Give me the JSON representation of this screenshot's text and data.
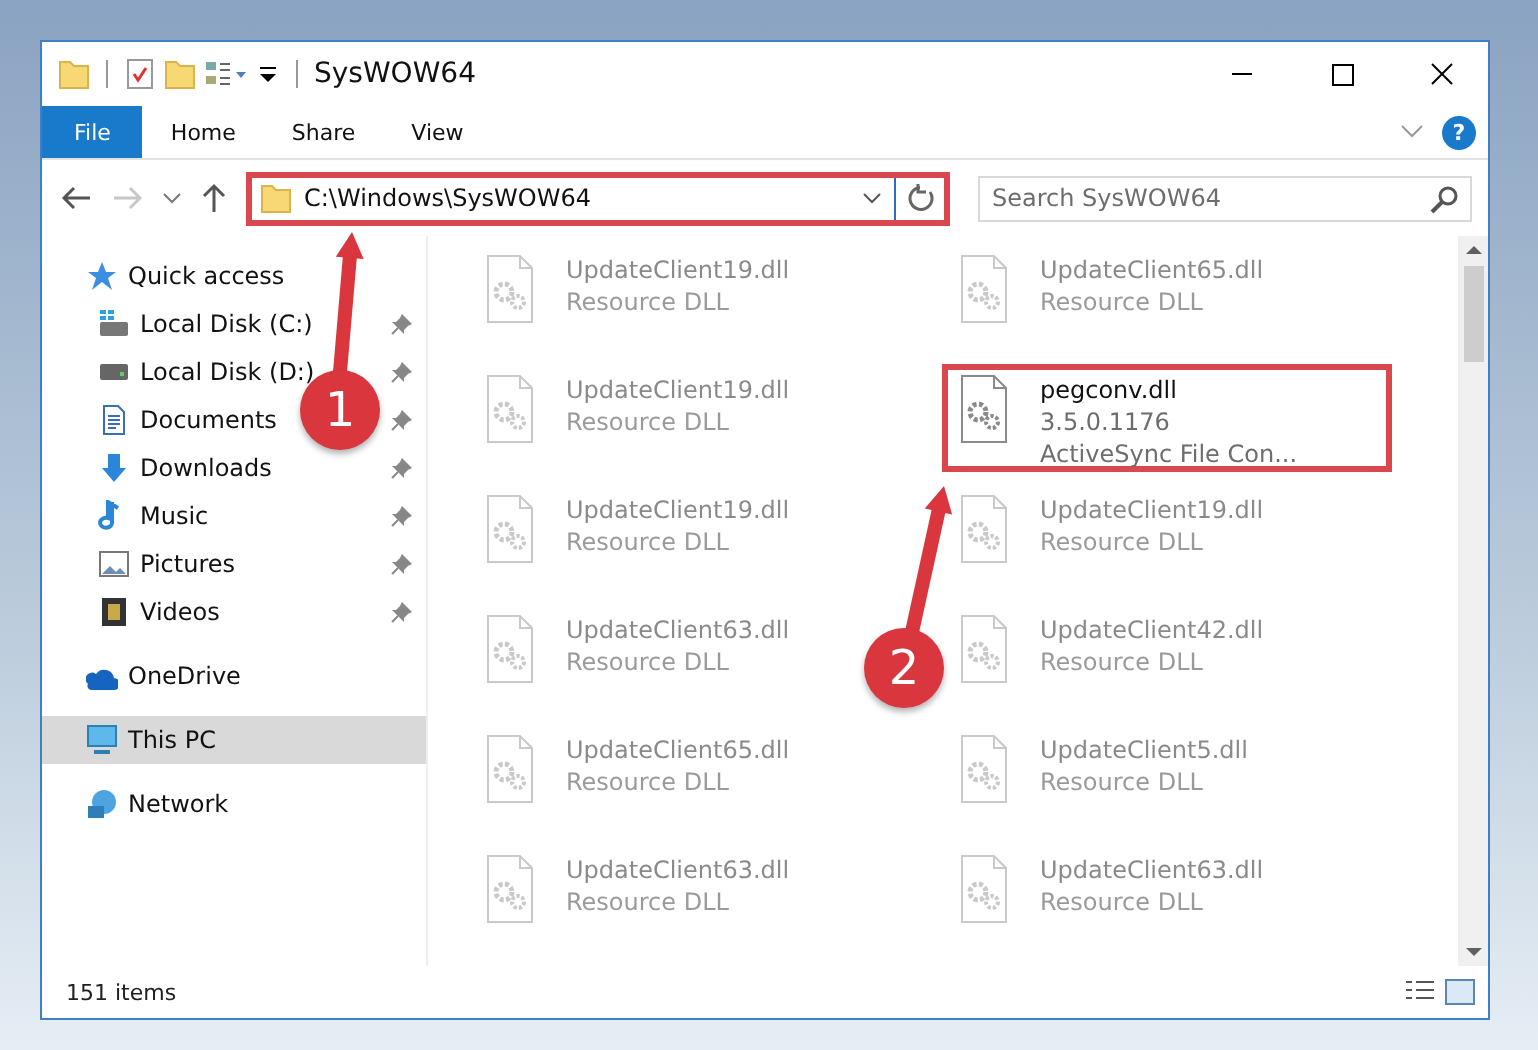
{
  "window": {
    "title": "SysWOW64"
  },
  "ribbon": {
    "tabs": [
      {
        "label": "File",
        "kind": "file",
        "selected": false
      },
      {
        "label": "Home",
        "kind": "tab",
        "selected": false
      },
      {
        "label": "Share",
        "kind": "tab",
        "selected": false
      },
      {
        "label": "View",
        "kind": "tab",
        "selected": false
      }
    ],
    "help": "?"
  },
  "navigation": {
    "forward_disabled": true
  },
  "address_bar": {
    "path": "C:\\Windows\\SysWOW64",
    "annotated": true
  },
  "search": {
    "placeholder": "Search SysWOW64"
  },
  "sidebar": {
    "items": [
      {
        "label": "Quick access",
        "selected": false,
        "children": [
          {
            "label": "Local Disk (C:)",
            "pinned": true,
            "selected": false
          },
          {
            "label": "Local Disk (D:)",
            "pinned": true,
            "selected": false
          },
          {
            "label": "Documents",
            "pinned": true,
            "selected": false
          },
          {
            "label": "Downloads",
            "pinned": true,
            "selected": false
          },
          {
            "label": "Music",
            "pinned": true,
            "selected": false
          },
          {
            "label": "Pictures",
            "pinned": true,
            "selected": false
          },
          {
            "label": "Videos",
            "pinned": true,
            "selected": false
          }
        ]
      },
      {
        "label": "OneDrive",
        "selected": false
      },
      {
        "label": "This PC",
        "selected": true
      },
      {
        "label": "Network",
        "selected": false
      }
    ]
  },
  "files": [
    {
      "name": "UpdateClient19.dll",
      "lines": [
        "Resource DLL"
      ],
      "dimmed": true,
      "annotated": false
    },
    {
      "name": "UpdateClient65.dll",
      "lines": [
        "Resource DLL"
      ],
      "dimmed": true,
      "annotated": false
    },
    {
      "name": "UpdateClient19.dll",
      "lines": [
        "Resource DLL"
      ],
      "dimmed": true,
      "annotated": false
    },
    {
      "name": "pegconv.dll",
      "lines": [
        "3.5.0.1176",
        "ActiveSync File Con..."
      ],
      "dimmed": false,
      "annotated": true
    },
    {
      "name": "UpdateClient19.dll",
      "lines": [
        "Resource DLL"
      ],
      "dimmed": true,
      "annotated": false
    },
    {
      "name": "UpdateClient19.dll",
      "lines": [
        "Resource DLL"
      ],
      "dimmed": true,
      "annotated": false
    },
    {
      "name": "UpdateClient63.dll",
      "lines": [
        "Resource DLL"
      ],
      "dimmed": true,
      "annotated": false
    },
    {
      "name": "UpdateClient42.dll",
      "lines": [
        "Resource DLL"
      ],
      "dimmed": true,
      "annotated": false
    },
    {
      "name": "UpdateClient65.dll",
      "lines": [
        "Resource DLL"
      ],
      "dimmed": true,
      "annotated": false
    },
    {
      "name": "UpdateClient5.dll",
      "lines": [
        "Resource DLL"
      ],
      "dimmed": true,
      "annotated": false
    },
    {
      "name": "UpdateClient63.dll",
      "lines": [
        "Resource DLL"
      ],
      "dimmed": true,
      "annotated": false
    },
    {
      "name": "UpdateClient63.dll",
      "lines": [
        "Resource DLL"
      ],
      "dimmed": true,
      "annotated": false
    }
  ],
  "callouts": [
    {
      "label": "1"
    },
    {
      "label": "2"
    }
  ],
  "status_bar": {
    "count": "151 items"
  }
}
